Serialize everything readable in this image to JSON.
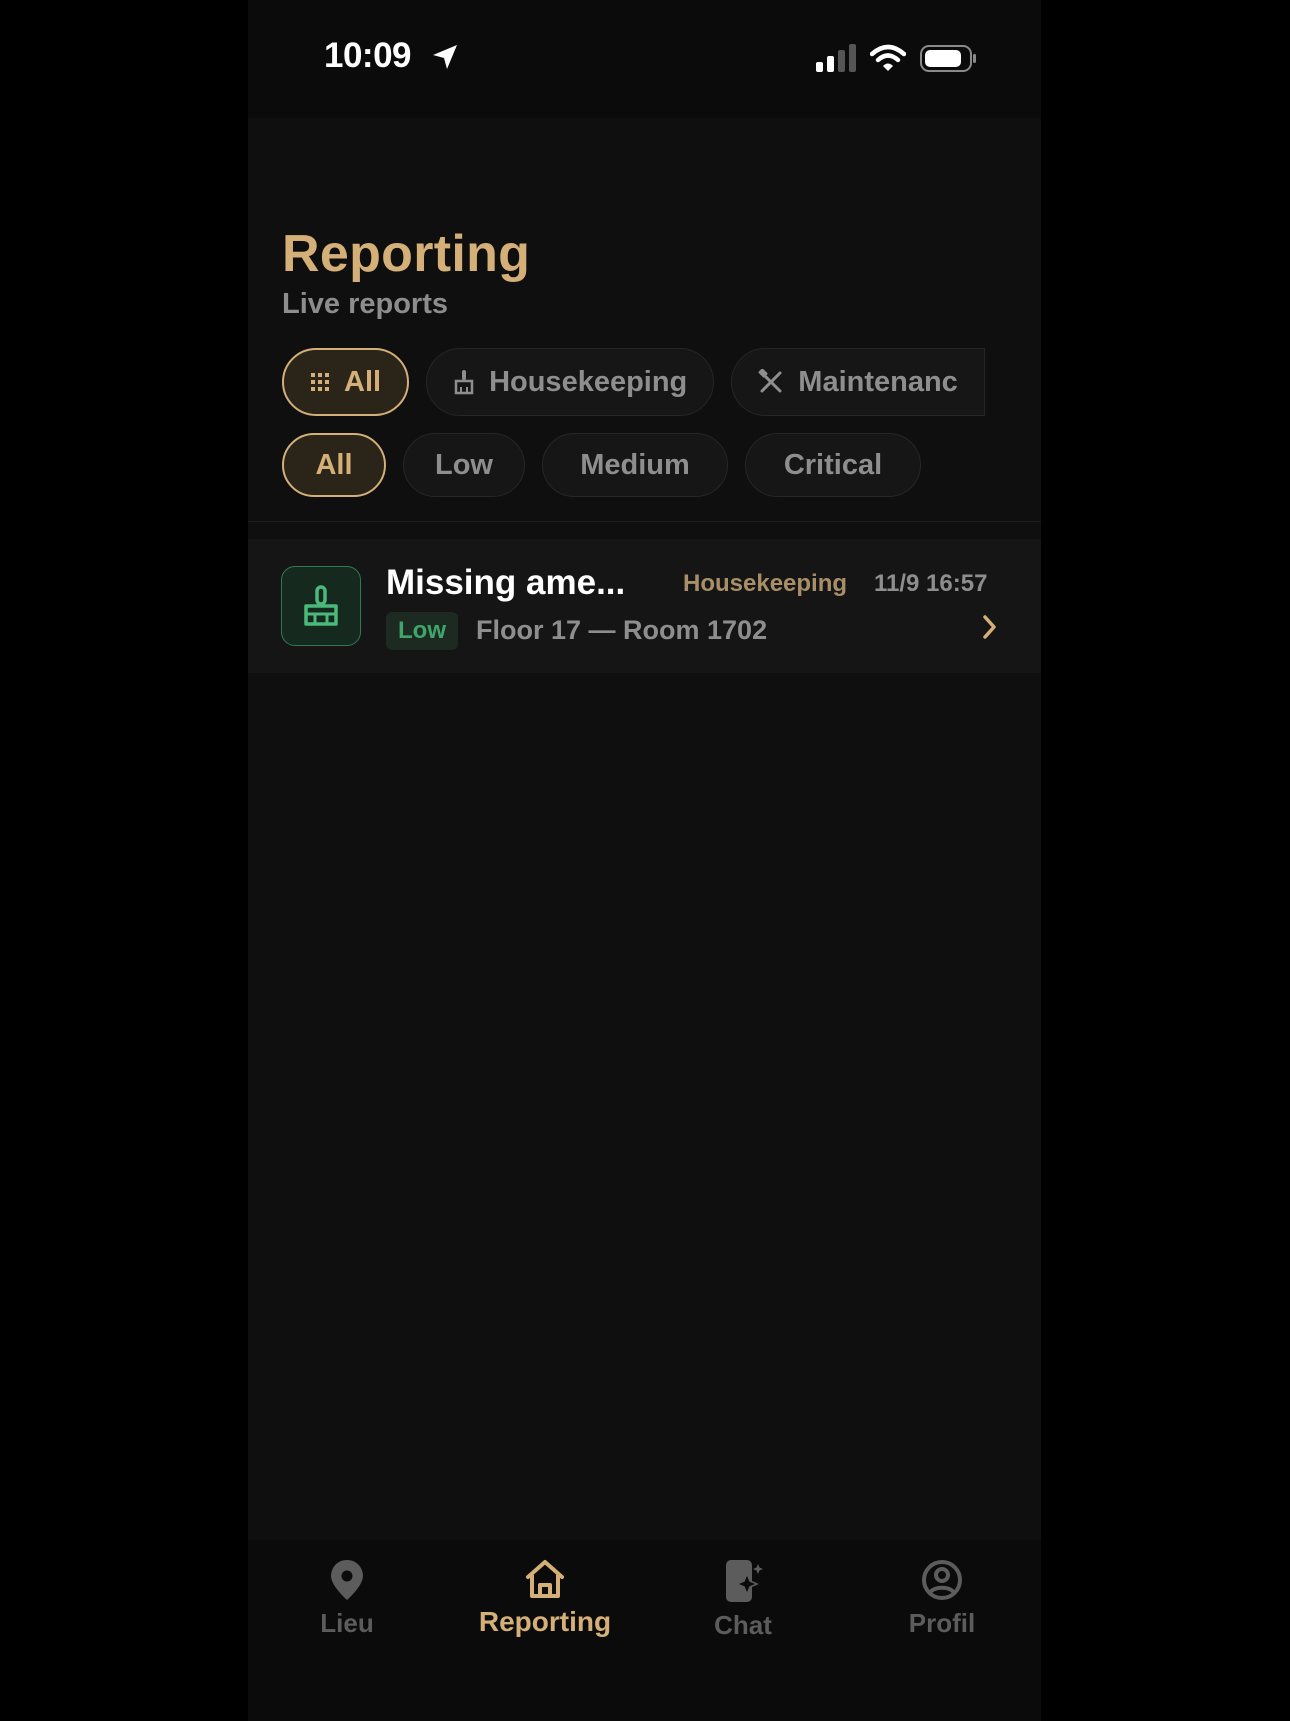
{
  "status_bar": {
    "time": "10:09"
  },
  "header": {
    "title": "Reporting",
    "subtitle": "Live reports"
  },
  "category_filters": [
    {
      "label": "All",
      "icon": "grid-icon",
      "active": true
    },
    {
      "label": "Housekeeping",
      "icon": "broom-icon",
      "active": false
    },
    {
      "label": "Maintenanc",
      "icon": "tools-icon",
      "active": false
    }
  ],
  "priority_filters": [
    {
      "label": "All",
      "active": true
    },
    {
      "label": "Low",
      "active": false
    },
    {
      "label": "Medium",
      "active": false
    },
    {
      "label": "Critical",
      "active": false
    }
  ],
  "reports": [
    {
      "title": "Missing ame...",
      "category": "Housekeeping",
      "time": "11/9 16:57",
      "priority": "Low",
      "location": "Floor 17 — Room 1702",
      "icon": "broom-icon"
    }
  ],
  "tab_bar": [
    {
      "label": "Lieu",
      "icon": "location-pin-icon",
      "active": false
    },
    {
      "label": "Reporting",
      "icon": "home-icon",
      "active": true
    },
    {
      "label": "Chat",
      "icon": "phone-sparkle-icon",
      "active": false
    },
    {
      "label": "Profil",
      "icon": "profile-icon",
      "active": false
    }
  ],
  "colors": {
    "accent": "#d4b078",
    "low_priority": "#3fa56a",
    "background": "#0f0f0f"
  }
}
